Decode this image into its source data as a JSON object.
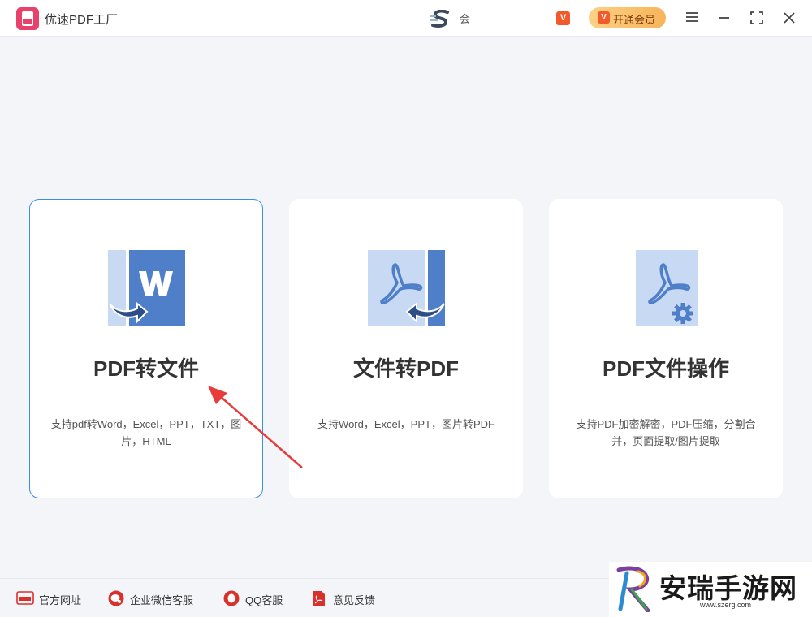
{
  "titlebar": {
    "app_title": "优速PDF工厂",
    "center_text": "会",
    "vip_small_label": "V",
    "vip_button_label": "开通会员",
    "vip_icon_label": "V"
  },
  "cards": [
    {
      "title": "PDF转文件",
      "desc": "支持pdf转Word，Excel，PPT，TXT，图片，HTML",
      "icon": "pdf-to-word-icon",
      "selected": true
    },
    {
      "title": "文件转PDF",
      "desc": "支持Word，Excel，PPT，图片转PDF",
      "icon": "file-to-pdf-icon",
      "selected": false
    },
    {
      "title": "PDF文件操作",
      "desc": "支持PDF加密解密，PDF压缩，分割合并，页面提取/图片提取",
      "icon": "pdf-operations-icon",
      "selected": false
    }
  ],
  "footer": {
    "items": [
      {
        "label": "官方网址",
        "icon": "website-icon"
      },
      {
        "label": "企业微信客服",
        "icon": "wechat-work-icon"
      },
      {
        "label": "QQ客服",
        "icon": "qq-icon"
      },
      {
        "label": "意见反馈",
        "icon": "feedback-icon"
      }
    ]
  },
  "watermark": {
    "title": "安瑞手游网",
    "url": "www.szerg.com"
  },
  "colors": {
    "accent_blue": "#3a8ee6",
    "icon_blue_dark": "#4f7fc9",
    "icon_blue_light": "#c8d9f3",
    "brand_pink": "#e8416b",
    "vip_orange": "#f25a2b",
    "arrow_red": "#e83b3b"
  }
}
